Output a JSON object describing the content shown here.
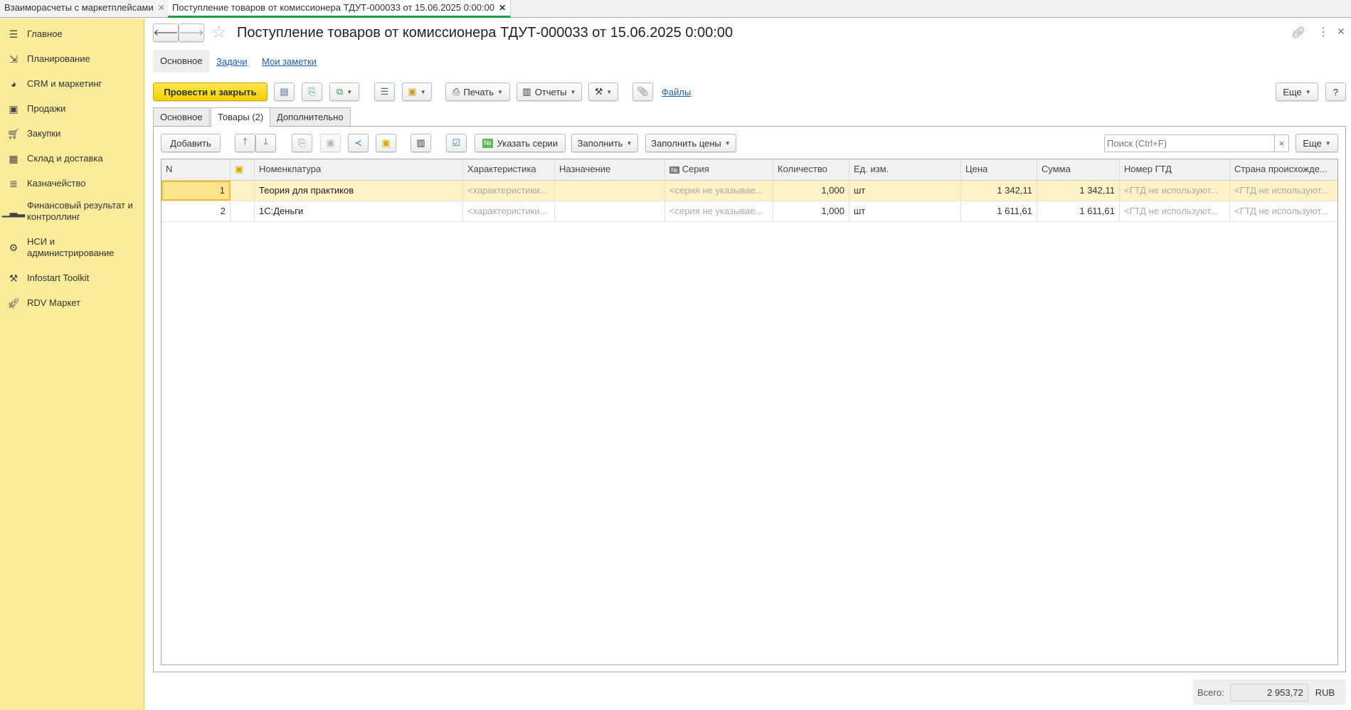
{
  "window_tabs": [
    {
      "label": "Взаиморасчеты с маркетплейсами",
      "active": false
    },
    {
      "label": "Поступление товаров от комиссионера ТДУТ-000033 от 15.06.2025 0:00:00",
      "active": true
    }
  ],
  "sidebar": {
    "items": [
      {
        "icon": "menu-icon",
        "label": "Главное"
      },
      {
        "icon": "planning-icon",
        "label": "Планирование"
      },
      {
        "icon": "pie-chart-icon",
        "label": "CRM и маркетинг"
      },
      {
        "icon": "shopping-bag-icon",
        "label": "Продажи"
      },
      {
        "icon": "cart-icon",
        "label": "Закупки"
      },
      {
        "icon": "warehouse-icon",
        "label": "Склад и доставка"
      },
      {
        "icon": "coins-icon",
        "label": "Казначейство"
      },
      {
        "icon": "bar-chart-icon",
        "label": "Финансовый результат и контроллинг"
      },
      {
        "icon": "gear-icon",
        "label": "НСИ и администрирование"
      },
      {
        "icon": "tools-icon",
        "label": "Infostart Toolkit"
      },
      {
        "icon": "rocket-icon",
        "label": "RDV Маркет"
      }
    ]
  },
  "header": {
    "title": "Поступление товаров от комиссионера ТДУТ-000033 от 15.06.2025 0:00:00"
  },
  "sections": {
    "main": "Основное",
    "tasks": "Задачи",
    "notes": "Мои заметки"
  },
  "toolbar": {
    "post_close": "Провести и закрыть",
    "print": "Печать",
    "reports": "Отчеты",
    "files": "Файлы",
    "more": "Еще",
    "help": "?"
  },
  "tabs": [
    {
      "label": "Основное"
    },
    {
      "label": "Товары (2)"
    },
    {
      "label": "Дополнительно"
    }
  ],
  "table_toolbar": {
    "add": "Добавить",
    "series": "Указать серии",
    "fill": "Заполнить",
    "fill_prices": "Заполнить цены",
    "search_placeholder": "Поиск (Ctrl+F)",
    "search_clear": "×",
    "more": "Еще"
  },
  "table": {
    "columns": [
      "N",
      "",
      "Номенклатура",
      "Характеристика",
      "Назначение",
      "Серия",
      "Количество",
      "Ед. изм.",
      "Цена",
      "Сумма",
      "Номер ГТД",
      "Страна происхожде..."
    ],
    "rows": [
      {
        "n": "1",
        "item": "Теория для практиков",
        "char": "<характеристики...",
        "purpose": "",
        "series": "<серия не указывае...",
        "qty": "1,000",
        "unit": "шт",
        "price": "1 342,11",
        "sum": "1 342,11",
        "gtd": "<ГТД не используют...",
        "country": "<ГТД не используют..."
      },
      {
        "n": "2",
        "item": "1С:Деньги",
        "char": "<характеристики...",
        "purpose": "",
        "series": "<серия не указывае...",
        "qty": "1,000",
        "unit": "шт",
        "price": "1 611,61",
        "sum": "1 611,61",
        "gtd": "<ГТД не используют...",
        "country": "<ГТД не используют..."
      }
    ]
  },
  "footer": {
    "total_label": "Всего:",
    "total": "2 953,72",
    "currency": "RUB"
  }
}
